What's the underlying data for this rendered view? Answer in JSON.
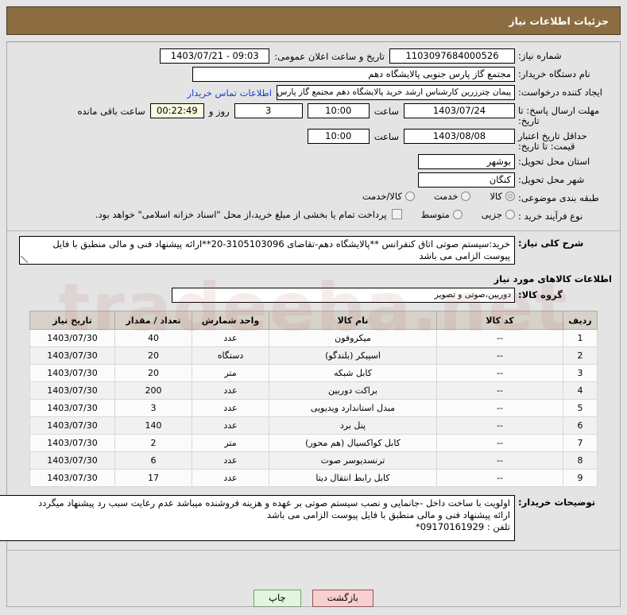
{
  "header": {
    "title": "جزئیات اطلاعات نیاز"
  },
  "form": {
    "need_number_label": "شماره نیاز:",
    "need_number_value": "1103097684000526",
    "public_announce_label": "تاریخ و ساعت اعلان عمومی:",
    "public_announce_value": "1403/07/21 - 09:03",
    "buyer_org_label": "نام دستگاه خریدار:",
    "buyer_org_value": "مجتمع گاز پارس جنوبی  پالایشگاه دهم",
    "requester_label": "ایجاد کننده درخواست:",
    "requester_value": "پیمان چترزرین کارشناس ارشد خرید پالایشگاه دهم مجتمع گاز پارس جنوبی  پالا",
    "buyer_contact_link": "اطلاعات تماس خریدار",
    "response_deadline_label": "مهلت ارسال پاسخ: تا تاریخ:",
    "response_deadline_date": "1403/07/24",
    "response_deadline_hour_label": "ساعت",
    "response_deadline_hour": "10:00",
    "remaining_days": "3",
    "remaining_days_label": "روز و",
    "remaining_timer": "00:22:49",
    "remaining_suffix": "ساعت باقی مانده",
    "price_validity_label": "حداقل تاریخ اعتبار قیمت: تا تاریخ:",
    "price_validity_date": "1403/08/08",
    "price_validity_hour_label": "ساعت",
    "price_validity_hour": "10:00",
    "province_label": "استان محل تحویل:",
    "province_value": "بوشهر",
    "city_label": "شهر محل تحویل:",
    "city_value": "کنگان",
    "category_label": "طبقه بندی موضوعی:",
    "category_options": [
      "کالا",
      "خدمت",
      "کالا/خدمت"
    ],
    "category_selected": "کالا",
    "process_label": "نوع فرآیند خرید :",
    "process_options": [
      "جزیی",
      "متوسط"
    ],
    "process_selected": "",
    "treasury_note": "پرداخت تمام یا بخشی از مبلغ خرید،از محل \"اسناد خزانه اسلامی\" خواهد بود."
  },
  "description": {
    "label": "شرح کلی نیاز:",
    "text": "خرید:سیستم صوتی اتاق کنفرانس **پالایشگاه دهم-تقاضای 3105103096-20**ارائه پیشنهاد فنی و مالی منطبق با فایل پیوست الزامی می باشد"
  },
  "goods_section": {
    "heading": "اطلاعات کالاهای مورد نیاز",
    "group_label": "گروه کالا:",
    "group_value": "دوربین،صوتی و تصویر"
  },
  "table": {
    "columns": [
      "ردیف",
      "کد کالا",
      "نام کالا",
      "واحد شمارش",
      "تعداد / مقدار",
      "تاریخ نیاز"
    ],
    "rows": [
      {
        "row": "1",
        "code": "--",
        "name": "میکروفون",
        "unit": "عدد",
        "qty": "40",
        "date": "1403/07/30"
      },
      {
        "row": "2",
        "code": "--",
        "name": "اسپیکر (بلندگو)",
        "unit": "دستگاه",
        "qty": "20",
        "date": "1403/07/30"
      },
      {
        "row": "3",
        "code": "--",
        "name": "کابل شبکه",
        "unit": "متر",
        "qty": "20",
        "date": "1403/07/30"
      },
      {
        "row": "4",
        "code": "--",
        "name": "براکت دوربین",
        "unit": "عدد",
        "qty": "200",
        "date": "1403/07/30"
      },
      {
        "row": "5",
        "code": "--",
        "name": "مبدل استاندارد ویدیویی",
        "unit": "عدد",
        "qty": "3",
        "date": "1403/07/30"
      },
      {
        "row": "6",
        "code": "--",
        "name": "پنل برد",
        "unit": "عدد",
        "qty": "140",
        "date": "1403/07/30"
      },
      {
        "row": "7",
        "code": "--",
        "name": "کابل کواکسیال (هم محور)",
        "unit": "متر",
        "qty": "2",
        "date": "1403/07/30"
      },
      {
        "row": "8",
        "code": "--",
        "name": "ترنسدیوسر صوت",
        "unit": "عدد",
        "qty": "6",
        "date": "1403/07/30"
      },
      {
        "row": "9",
        "code": "--",
        "name": "کابل رابط انتقال دیتا",
        "unit": "عدد",
        "qty": "17",
        "date": "1403/07/30"
      }
    ]
  },
  "notes": {
    "label": "توضیحات خریدار:",
    "line1": "اولویت با ساخت داخل -جانمایی و نصب سیستم صوتی بر عهده و هزینه فروشنده میباشد عدم رعایت سبب رد پیشنهاد میگردد",
    "line2": "ارائه پیشنهاد فنی و مالی منطبق با فایل پیوست الزامی می باشد",
    "line3": "تلفن : 09170161929*"
  },
  "buttons": {
    "back": "بازگشت",
    "print": "چاپ"
  },
  "watermark": "tradeeba.net"
}
